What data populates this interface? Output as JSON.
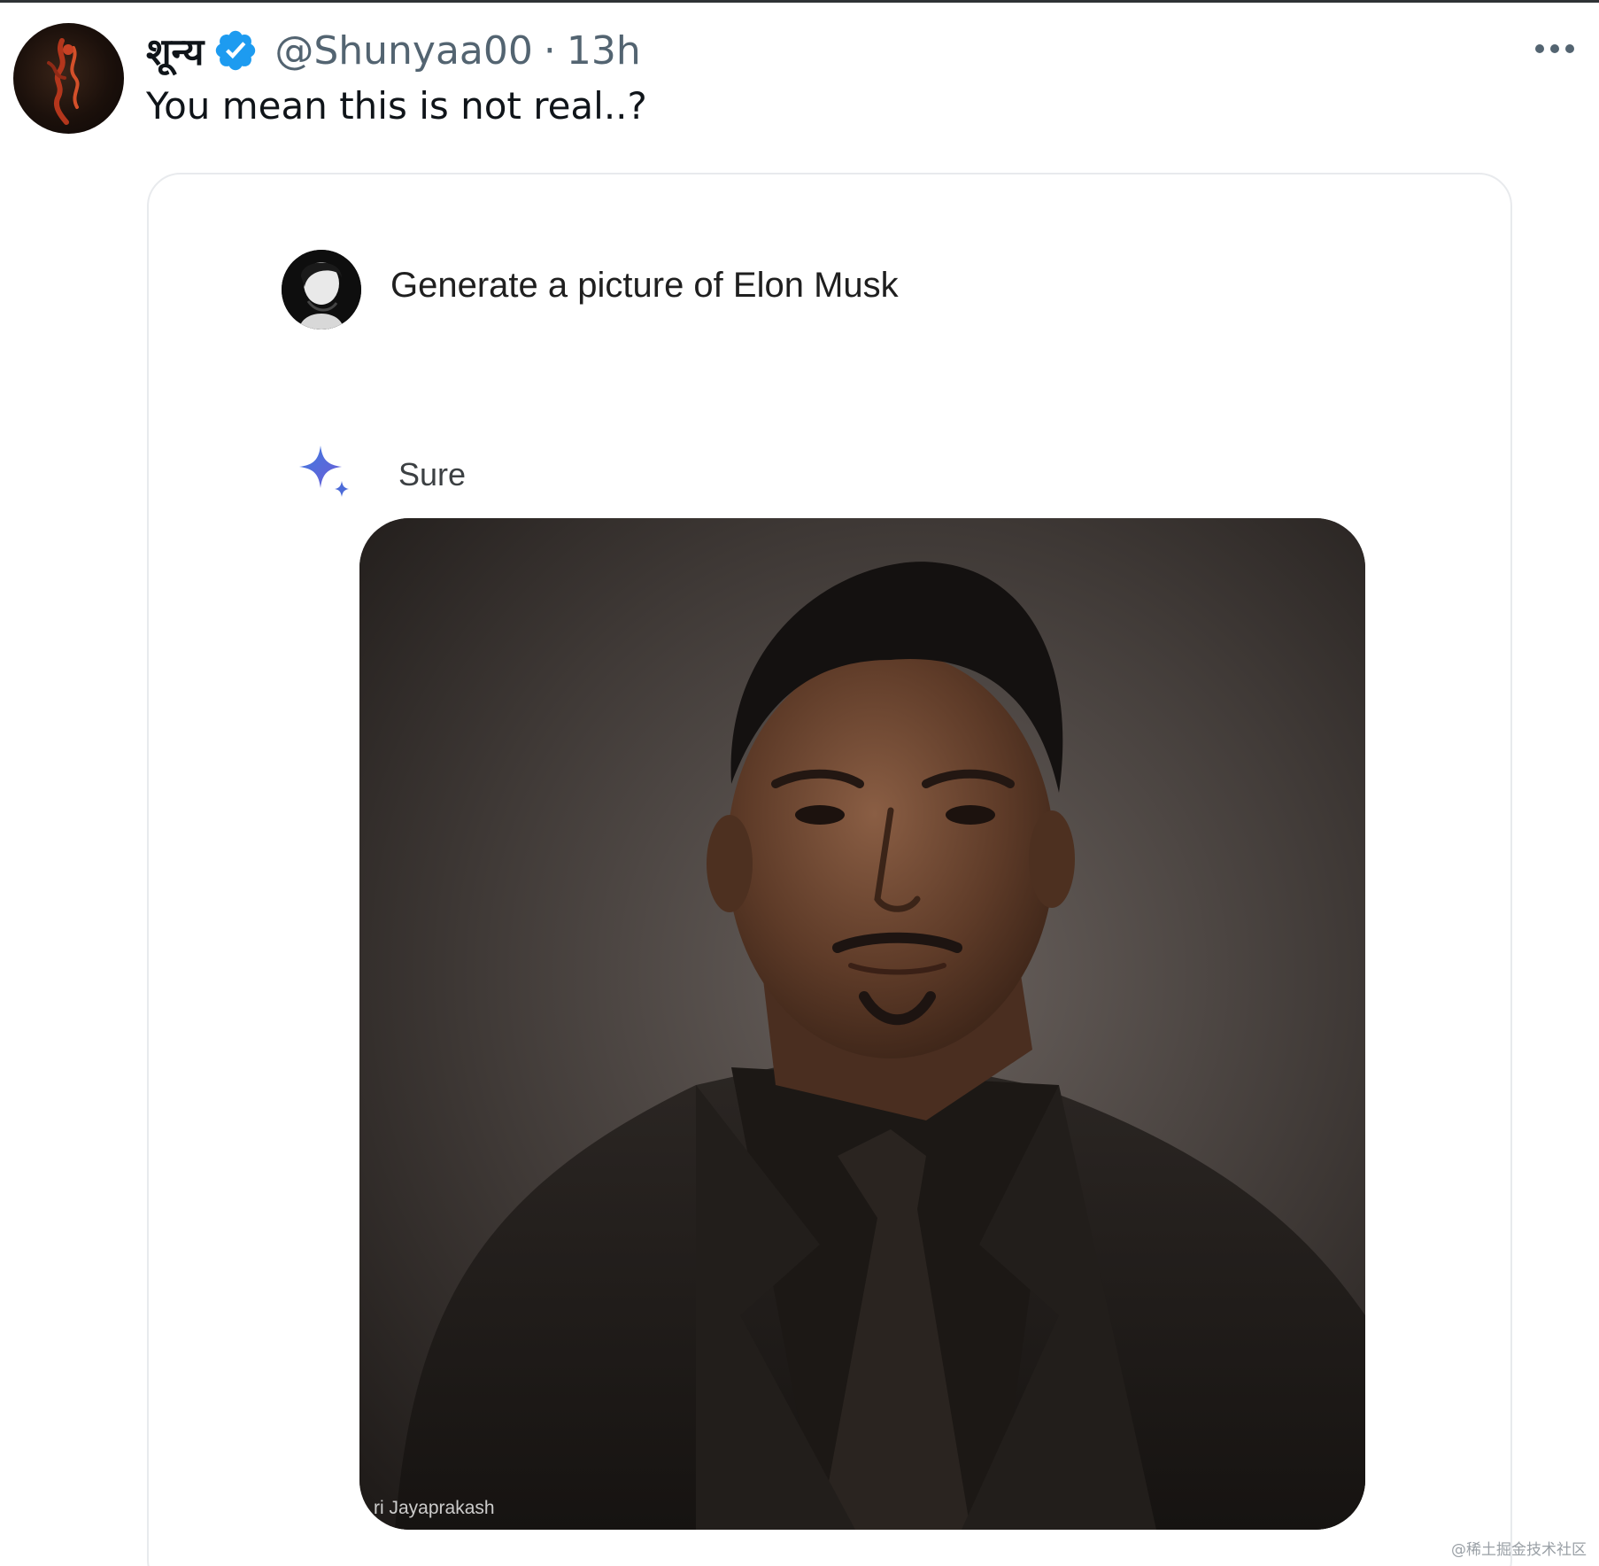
{
  "tweet": {
    "display_name": "शून्य",
    "handle": "@Shunyaa00",
    "separator": "·",
    "time": "13h",
    "text": "You mean this is not real..?"
  },
  "card": {
    "prompt": "Generate a picture of Elon Musk",
    "reply": "Sure",
    "image_credit": "ri Jayaprakash"
  },
  "watermark": "@稀土掘金技术社区",
  "icons": {
    "verified": "verified-badge-icon",
    "more": "more-options-icon",
    "sparkle": "gemini-sparkle-icon"
  },
  "colors": {
    "verified_blue": "#1d9bf0",
    "secondary_text": "#536471",
    "sparkle_blue": "#4c6bd8"
  }
}
